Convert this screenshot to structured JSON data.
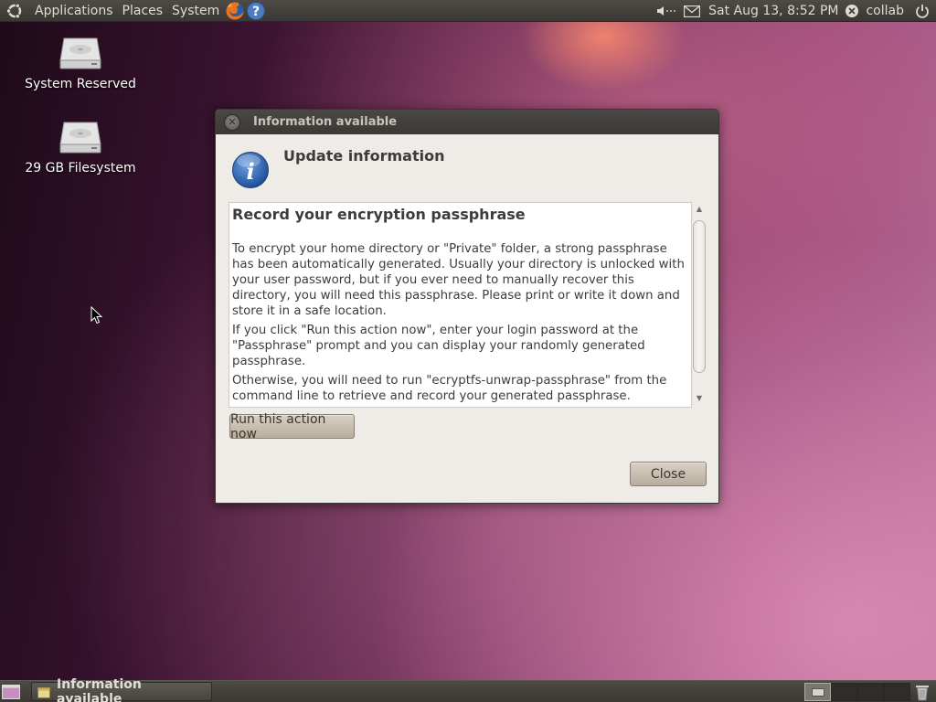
{
  "top_panel": {
    "menus": [
      "Applications",
      "Places",
      "System"
    ],
    "clock": "Sat Aug 13,  8:52 PM",
    "user": "collab",
    "icons": [
      "ubuntu-logo-icon",
      "firefox-icon",
      "help-icon",
      "volume-icon",
      "mail-icon",
      "user-status-icon",
      "power-icon"
    ]
  },
  "desktop": {
    "icons": [
      {
        "label": "System Reserved",
        "icon": "drive-icon"
      },
      {
        "label": "29 GB Filesystem",
        "icon": "drive-icon"
      }
    ]
  },
  "dialog": {
    "title": "Information available",
    "heading": "Update information",
    "content_title": "Record your encryption passphrase",
    "paragraphs": [
      "To encrypt your home directory or \"Private\" folder, a strong passphrase has been automatically generated. Usually your directory is unlocked with your user password, but if you ever need to manually recover this directory, you will need this passphrase. Please print or write it down and store it in a safe location.",
      "If you click \"Run this action now\", enter your login password at the \"Passphrase\" prompt and you can display your randomly generated passphrase.",
      "Otherwise, you will need to run \"ecryptfs-unwrap-passphrase\" from the command line to retrieve and record your generated passphrase."
    ],
    "run_button": "Run this action now",
    "close_button": "Close"
  },
  "bottom_panel": {
    "task": "Information available"
  },
  "colors": {
    "panel": "#3e3c38",
    "dialog_bg": "#efebe7",
    "button": "#c9c0b2"
  }
}
